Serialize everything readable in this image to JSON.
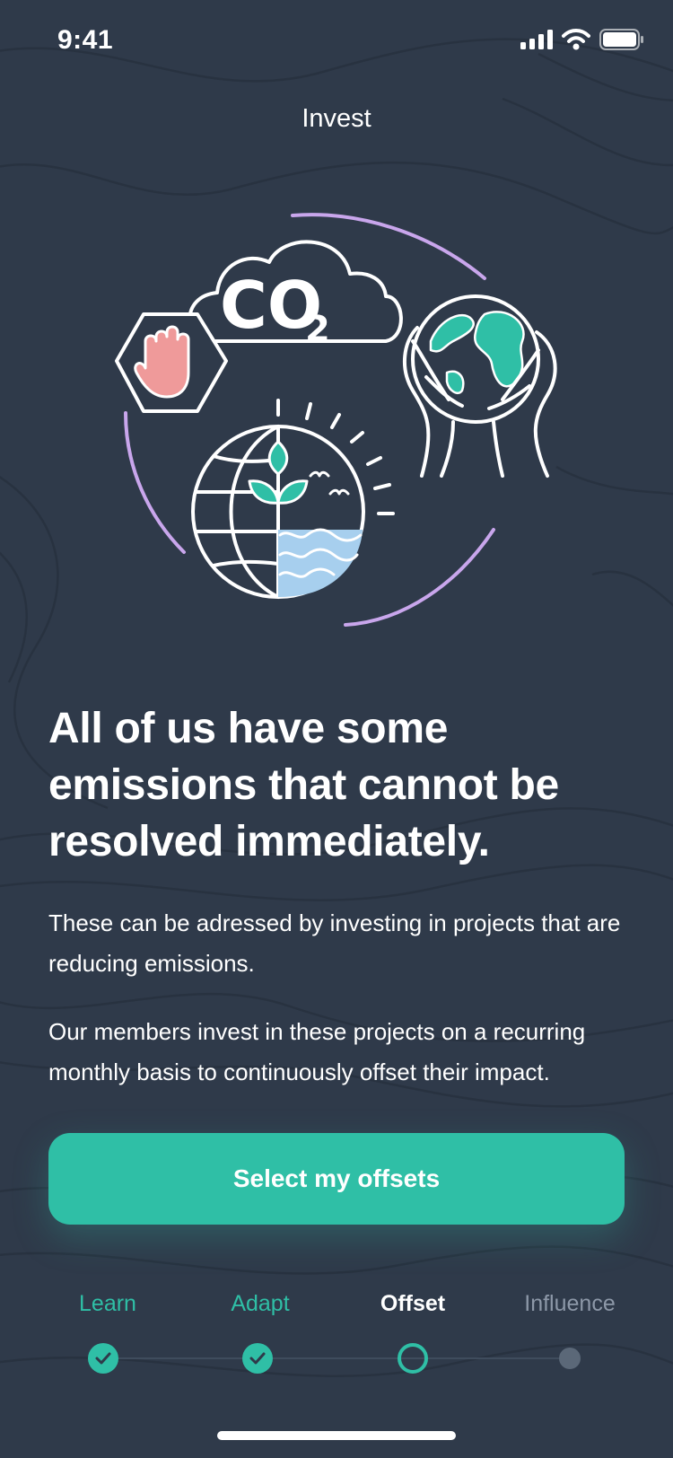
{
  "status_bar": {
    "time": "9:41",
    "icons": [
      "cellular-signal-icon",
      "wifi-icon",
      "battery-icon"
    ]
  },
  "nav": {
    "title": "Invest"
  },
  "illustration": {
    "co2_text": "CO",
    "co2_subscript": "2",
    "icons": [
      "co2-cloud-icon",
      "stop-hand-icon",
      "earth-in-hands-icon",
      "sustainable-globe-icon",
      "sun-rays-icon",
      "birds-icon"
    ]
  },
  "content": {
    "headline": "All of us have some emissions that cannot be resolved immediately.",
    "paragraph_1": "These can be adressed by investing in projects that are reducing emissions.",
    "paragraph_2": "Our members invest in these projects on a recurring monthly basis to continuously offset their impact."
  },
  "cta": {
    "label": "Select my offsets"
  },
  "progress_steps": [
    {
      "label": "Learn",
      "state": "done"
    },
    {
      "label": "Adapt",
      "state": "done"
    },
    {
      "label": "Offset",
      "state": "current"
    },
    {
      "label": "Influence",
      "state": "upcoming"
    }
  ],
  "colors": {
    "background": "#2f3a4a",
    "accent": "#2fbfa6",
    "arc": "#c9a6ec",
    "hand": "#ef9a9a",
    "water": "#a7cfee",
    "muted": "#8d98a8"
  }
}
